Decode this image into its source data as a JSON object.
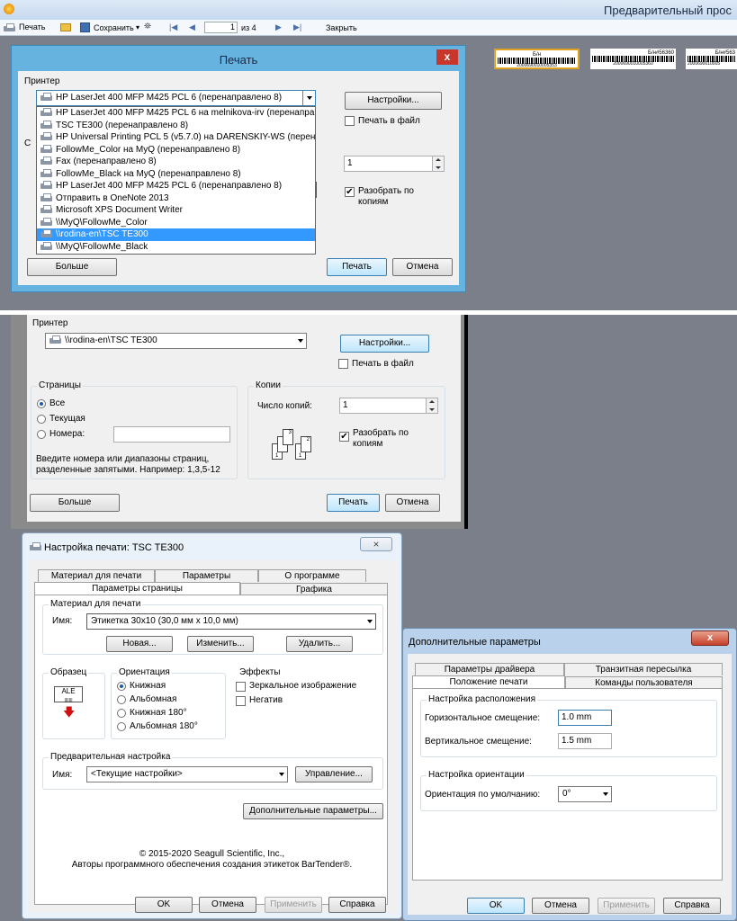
{
  "app": {
    "title": "Предварительный прос"
  },
  "toolbar": {
    "print": "Печать",
    "save": "Сохранить",
    "page_value": "1",
    "page_of": "из 4",
    "close": "Закрыть"
  },
  "labels": [
    {
      "title": "Б/н",
      "code": "2000690010005353"
    },
    {
      "title": "Б/н#56360",
      "code": "2000690010005360"
    },
    {
      "title": "Б/н#563",
      "code": "2000690010005"
    }
  ],
  "print1": {
    "title": "Печать",
    "group_printer": "Принтер",
    "selected_printer": "HP LaserJet 400 MFP M425 PCL 6 (перенаправлено 8)",
    "settings_btn": "Настройки...",
    "print_to_file": "Печать в файл",
    "copies_value": "1",
    "collate": "Разобрать по копиям",
    "more_btn": "Больше",
    "print_btn": "Печать",
    "cancel_btn": "Отмена",
    "printers": [
      "HP LaserJet 400 MFP M425 PCL 6 на melnikova-irv (перенаправ",
      "TSC TE300 (перенаправлено 8)",
      "HP Universal Printing PCL 5 (v5.7.0) на DARENSKIY-WS (перен",
      "FollowMe_Color на MyQ (перенаправлено 8)",
      "Fax (перенаправлено 8)",
      "FollowMe_Black на MyQ (перенаправлено 8)",
      "HP LaserJet 400 MFP M425 PCL 6 (перенаправлено 8)",
      "Отправить в OneNote 2013",
      "Microsoft XPS Document Writer",
      "\\\\MyQ\\FollowMe_Color",
      "\\\\rodina-en\\TSC TE300",
      "\\\\MyQ\\FollowMe_Black"
    ]
  },
  "print2": {
    "group_printer": "Принтер",
    "selected_printer": "\\\\rodina-en\\TSC TE300",
    "settings_btn": "Настройки...",
    "print_to_file": "Печать в файл",
    "group_pages": "Страницы",
    "all": "Все",
    "current": "Текущая",
    "numbers": "Номера:",
    "hint": "Введите номера или диапазоны страниц, разделенные запятыми. Например: 1,3,5-12",
    "group_copies": "Копии",
    "copies_label": "Число копий:",
    "copies_value": "1",
    "collate": "Разобрать по копиям",
    "more_btn": "Больше",
    "print_btn": "Печать",
    "cancel_btn": "Отмена"
  },
  "setup": {
    "title": "Настройка печати: TSC TE300",
    "tabs_back": [
      "Материал для печати",
      "Параметры",
      "О программе"
    ],
    "tabs_front": [
      "Параметры страницы",
      "Графика"
    ],
    "group_media": "Материал для печати",
    "name_label": "Имя:",
    "media_value": "Этикетка 30x10 (30,0 мм x 10,0 мм)",
    "new_btn": "Новая...",
    "edit_btn": "Изменить...",
    "delete_btn": "Удалить...",
    "group_sample": "Образец",
    "sample_text": "ALE",
    "group_orient": "Ориентация",
    "orients": [
      "Книжная",
      "Альбомная",
      "Книжная 180°",
      "Альбомная 180°"
    ],
    "group_effects": "Эффекты",
    "mirror": "Зеркальное изображение",
    "negative": "Негатив",
    "group_preset": "Предварительная настройка",
    "preset_value": "<Текущие настройки>",
    "manage_btn": "Управление...",
    "advanced_btn": "Дополнительные параметры...",
    "copyright1": "© 2015-2020 Seagull Scientific, Inc.,",
    "copyright2": "Авторы программного обеспечения создания этикеток BarTender®.",
    "ok": "OK",
    "cancel": "Отмена",
    "apply": "Применить",
    "help": "Справка"
  },
  "advanced": {
    "title": "Дополнительные параметры",
    "tabs_back": [
      "Параметры драйвера",
      "Транзитная пересылка"
    ],
    "tabs_front": [
      "Положение печати",
      "Команды пользователя"
    ],
    "group_pos": "Настройка расположения",
    "h_offset_label": "Горизонтальное смещение:",
    "h_offset": "1.0 mm",
    "v_offset_label": "Вертикальное смещение:",
    "v_offset": "1.5 mm",
    "group_orient": "Настройка ориентации",
    "default_orient_label": "Ориентация по умолчанию:",
    "default_orient": "0°",
    "ok": "OK",
    "cancel": "Отмена",
    "apply": "Применить",
    "help": "Справка"
  }
}
